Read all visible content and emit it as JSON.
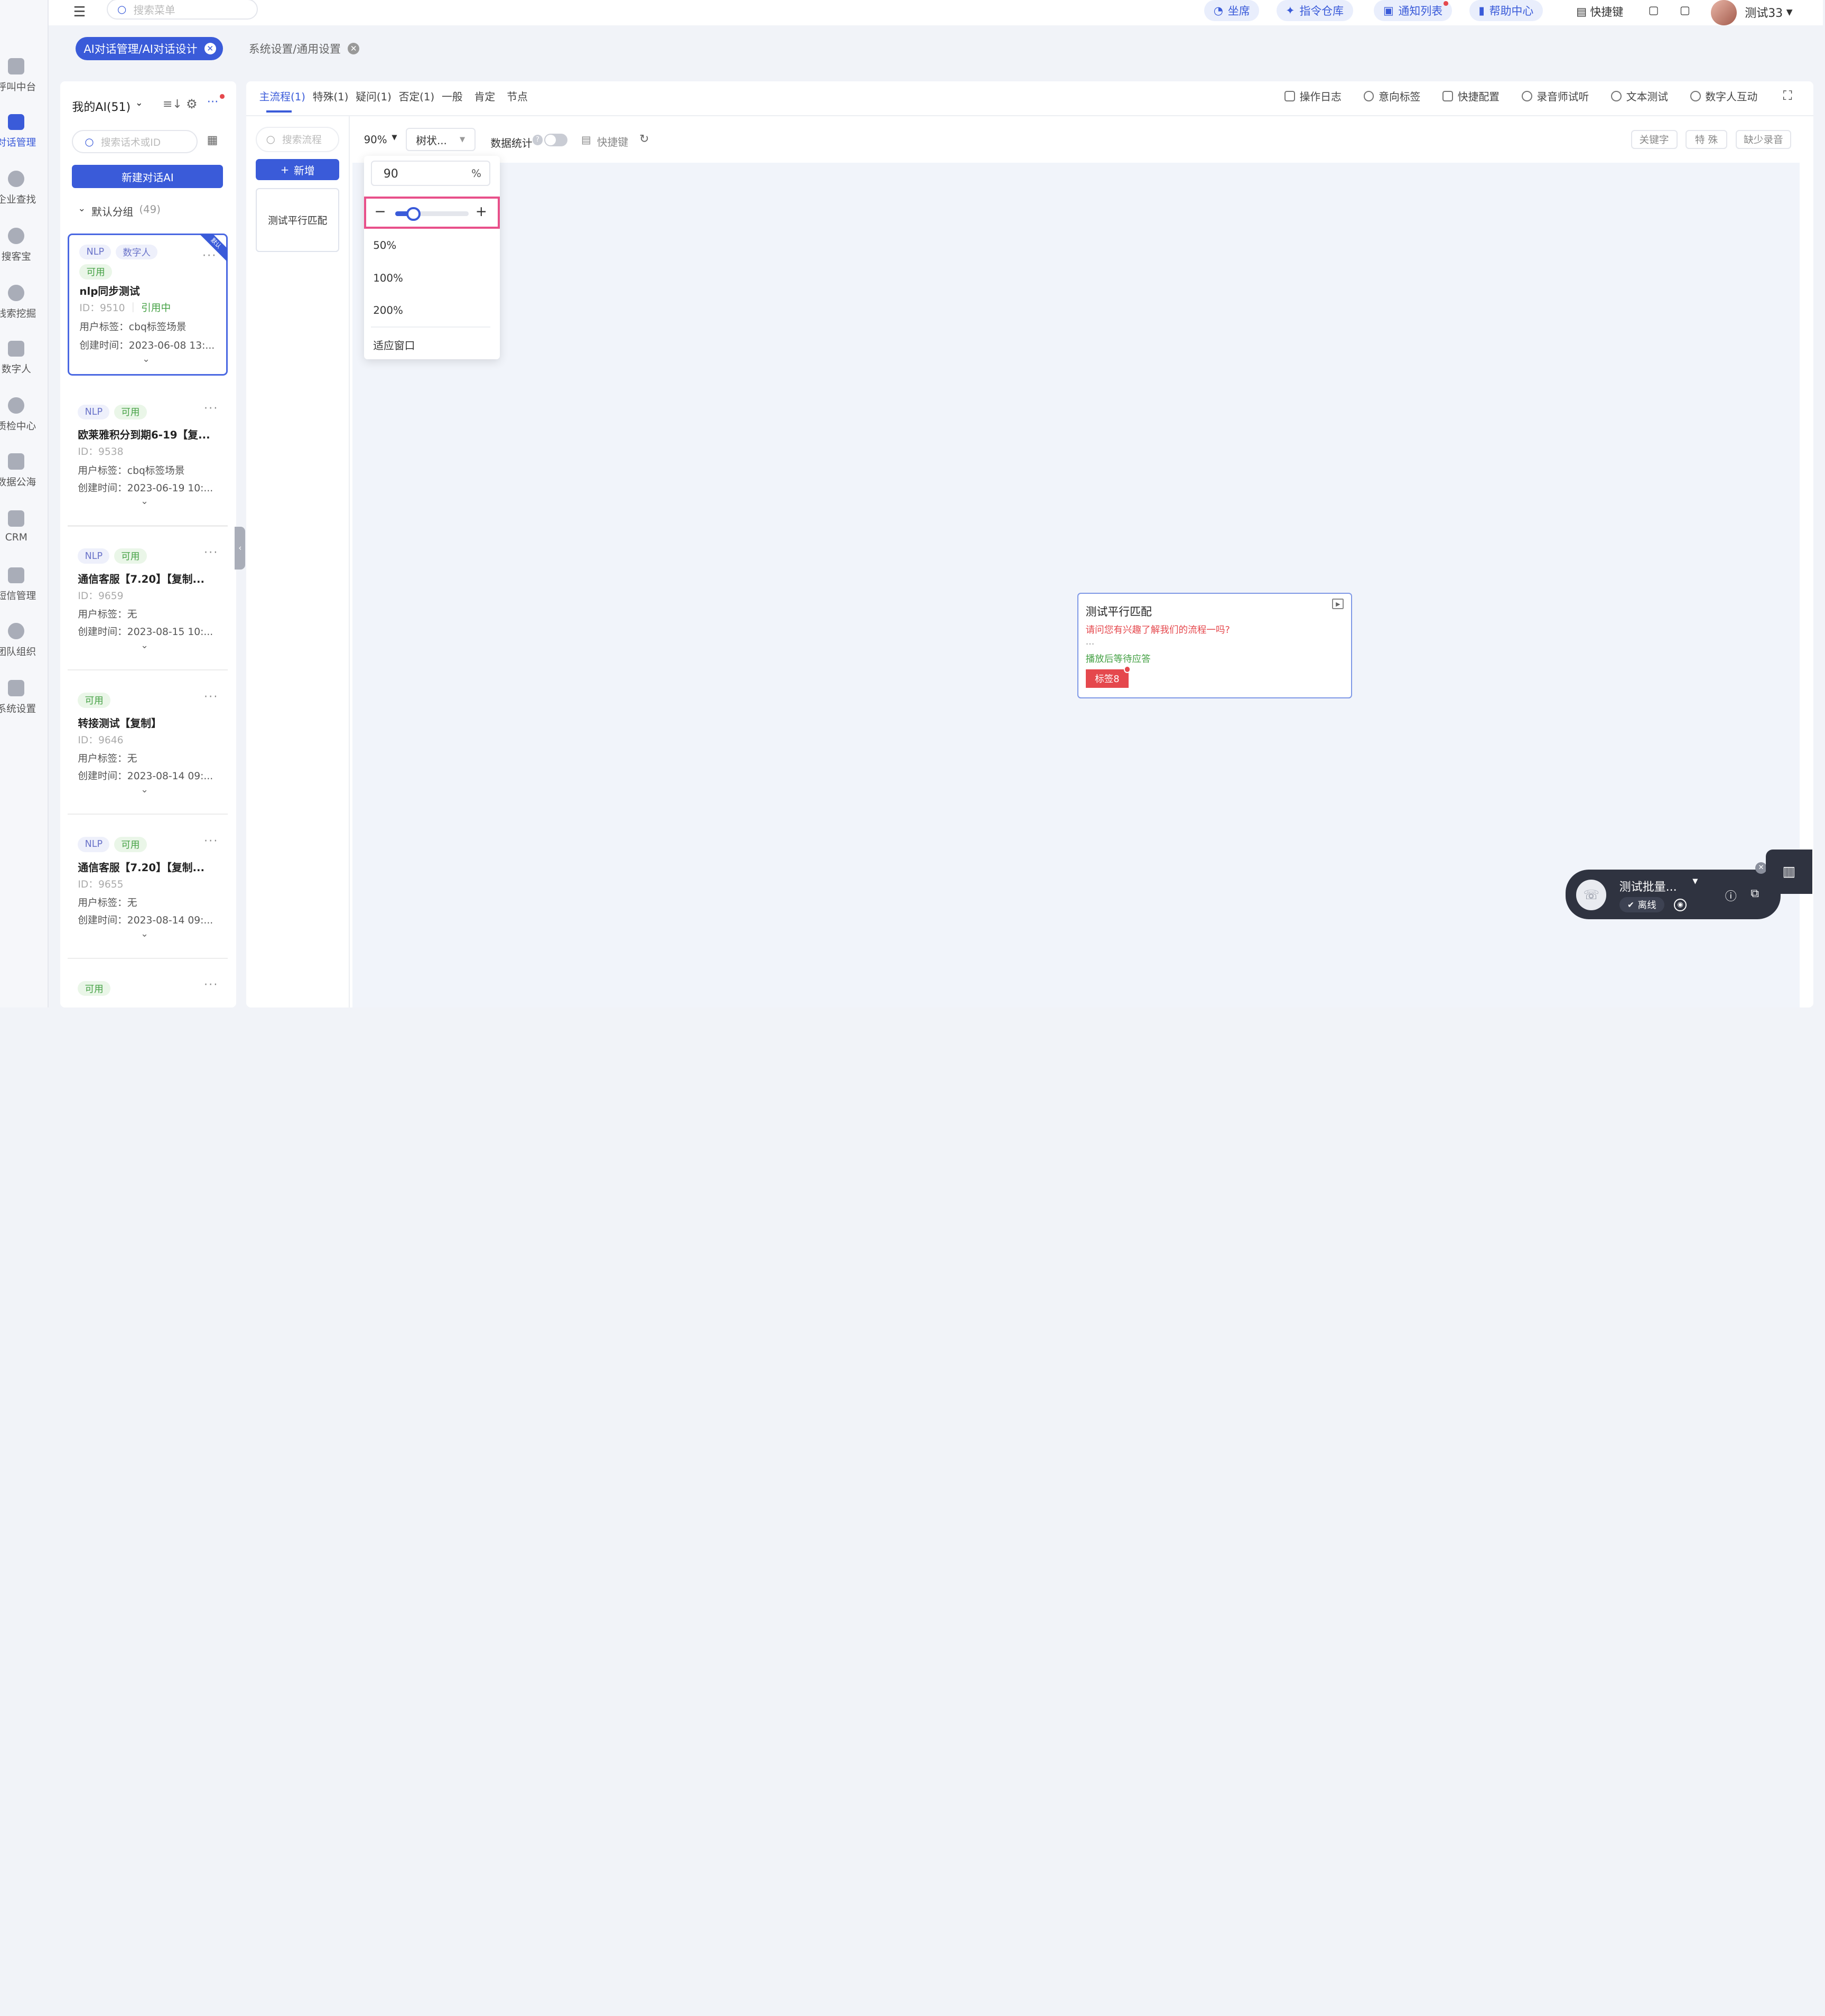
{
  "topbar": {
    "search_placeholder": "搜索菜单",
    "pills": [
      "坐席",
      "指令仓库",
      "通知列表",
      "帮助中心"
    ],
    "shortcut_label": "快捷键",
    "username": "测试33"
  },
  "rail": {
    "items": [
      "呼叫中台",
      "对话管理",
      "企业查找",
      "搜客宝",
      "线索挖掘",
      "数字人",
      "质检中心",
      "数据公海",
      "CRM",
      "短信管理",
      "团队组织",
      "系统设置"
    ],
    "active_index": 1
  },
  "tabs": [
    {
      "label": "AI对话管理/AI对话设计",
      "active": true
    },
    {
      "label": "系统设置/通用设置",
      "active": false
    }
  ],
  "sidebar": {
    "title": "我的AI(51)",
    "search_placeholder": "搜索话术或ID",
    "new_button": "新建对话AI",
    "group_label": "默认分组",
    "group_count": "(49)",
    "corner_badge": "默认",
    "cards": [
      {
        "tags": [
          "NLP",
          "数字人",
          "可用"
        ],
        "title": "nlp同步测试",
        "id": "ID：9510",
        "ref": "引用中",
        "user_tag": "用户标签：cbq标签场景",
        "created": "创建时间：2023-06-08 13:..."
      },
      {
        "tags": [
          "NLP",
          "可用"
        ],
        "title": "欧莱雅积分到期6-19【复...",
        "id": "ID：9538",
        "user_tag": "用户标签：cbq标签场景",
        "created": "创建时间：2023-06-19 10:..."
      },
      {
        "tags": [
          "NLP",
          "可用"
        ],
        "title": "通信客服【7.20】【复制...",
        "id": "ID：9659",
        "user_tag": "用户标签：无",
        "created": "创建时间：2023-08-15 10:..."
      },
      {
        "tags": [
          "可用"
        ],
        "title": "转接测试【复制】",
        "id": "ID：9646",
        "user_tag": "用户标签：无",
        "created": "创建时间：2023-08-14 09:..."
      },
      {
        "tags": [
          "NLP",
          "可用"
        ],
        "title": "通信客服【7.20】【复制...",
        "id": "ID：9655",
        "user_tag": "用户标签：无",
        "created": "创建时间：2023-08-14 09:..."
      },
      {
        "tags": [
          "可用"
        ]
      }
    ]
  },
  "main": {
    "tabs": [
      "主流程(1)",
      "特殊(1)",
      "疑问(1)",
      "否定(1)",
      "一般",
      "肯定",
      "节点"
    ],
    "tools": [
      "操作日志",
      "意向标签",
      "快捷配置",
      "录音师试听",
      "文本测试",
      "数字人互动"
    ],
    "flow_search_placeholder": "搜索流程",
    "add_button": "新增",
    "flow_item": "测试平行匹配",
    "zoom_value": "90%",
    "layout_select": "树状...",
    "data_stats_label": "数据统计",
    "shortcut_label": "快捷键",
    "right_chips": [
      "关键字",
      "特 殊",
      "缺少录音"
    ],
    "data_stats_enabled": false
  },
  "zoom_dropdown": {
    "input_value": "90",
    "unit": "%",
    "slider_level": 0.25,
    "options": [
      "50%",
      "100%",
      "200%",
      "适应窗口"
    ]
  },
  "node": {
    "title": "测试平行匹配",
    "prompt": "请问您有兴趣了解我们的流程一吗?",
    "ellipsis": "...",
    "wait_text": "播放后等待应答",
    "tag": "标签8"
  },
  "call_widget": {
    "name": "测试批量...",
    "status": "离线"
  },
  "colors": {
    "accent": "#3a5bd9",
    "tag_red": "#e5484d",
    "highlight": "#e8508a"
  }
}
